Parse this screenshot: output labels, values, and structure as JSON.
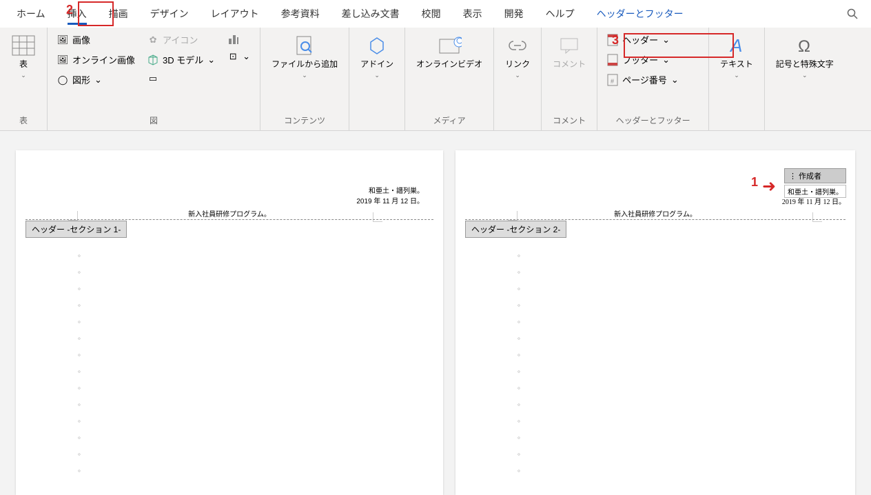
{
  "tabs": {
    "home": "ホーム",
    "insert": "挿入",
    "draw": "描画",
    "design": "デザイン",
    "layout": "レイアウト",
    "references": "参考資料",
    "mailings": "差し込み文書",
    "review": "校閲",
    "view": "表示",
    "developer": "開発",
    "help": "ヘルプ",
    "contextual": "ヘッダーとフッター"
  },
  "ribbon": {
    "table": {
      "label": "表",
      "button": "表"
    },
    "illustrations": {
      "label": "図",
      "images": "画像",
      "online_images": "オンライン画像",
      "shapes": "図形",
      "icons": "アイコン",
      "model3d": "3D モデル"
    },
    "content": {
      "label": "コンテンツ",
      "add_from_file": "ファイルから追加"
    },
    "addins": {
      "label": "",
      "button": "アドイン"
    },
    "media": {
      "label": "メディア",
      "button": "オンラインビデオ"
    },
    "link": {
      "label": "",
      "button": "リンク"
    },
    "comment": {
      "label": "コメント",
      "button": "コメント"
    },
    "hf": {
      "label": "ヘッダーとフッター",
      "header": "ヘッダー",
      "footer": "フッター",
      "page_number": "ページ番号"
    },
    "text": {
      "label": "",
      "button": "テキスト"
    },
    "symbols": {
      "label": "",
      "button": "記号と特殊文字"
    }
  },
  "annotations": {
    "n1": "1",
    "n2": "2",
    "n3": "3"
  },
  "pages": {
    "p1": {
      "author": "和亜土・譜列巣。",
      "date": "2019 年 11 月 12 日。",
      "title": "新入社員研修プログラム。",
      "section": "ヘッダー  -セクション 1-"
    },
    "p2": {
      "creator_label": "作成者",
      "author": "和亜土・譜列巣。",
      "date": "2019 年 11 月 12 日。",
      "title": "新入社員研修プログラム。",
      "section": "ヘッダー  -セクション 2-"
    }
  }
}
